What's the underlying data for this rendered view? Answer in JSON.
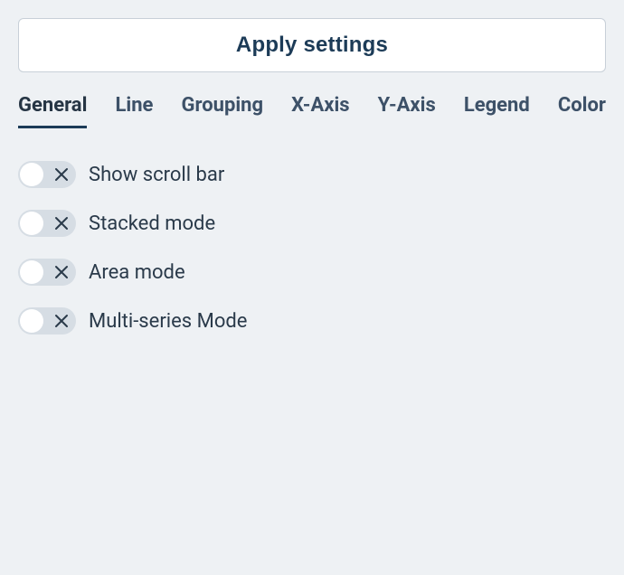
{
  "apply_button_label": "Apply settings",
  "tabs": [
    {
      "label": "General",
      "active": true
    },
    {
      "label": "Line",
      "active": false
    },
    {
      "label": "Grouping",
      "active": false
    },
    {
      "label": "X-Axis",
      "active": false
    },
    {
      "label": "Y-Axis",
      "active": false
    },
    {
      "label": "Legend",
      "active": false
    },
    {
      "label": "Color",
      "active": false
    }
  ],
  "options": [
    {
      "label": "Show scroll bar",
      "enabled": false
    },
    {
      "label": "Stacked mode",
      "enabled": false
    },
    {
      "label": "Area mode",
      "enabled": false
    },
    {
      "label": "Multi-series Mode",
      "enabled": false
    }
  ]
}
